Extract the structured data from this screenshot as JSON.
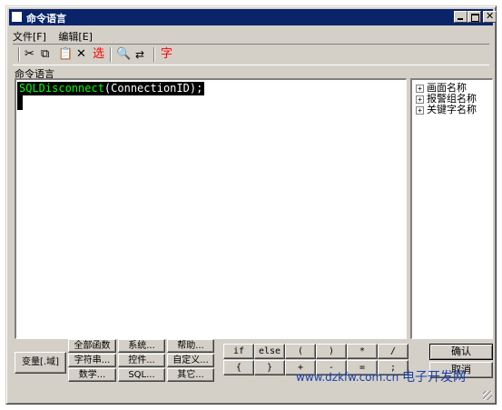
{
  "window": {
    "title": "命令语言"
  },
  "menu": [
    "文件[F]",
    "编辑[E]"
  ],
  "toolbar": {
    "icons": [
      "cut-icon",
      "copy-icon",
      "paste-icon",
      "delete-icon",
      "select-icon",
      "find-icon",
      "replace-icon",
      "font-icon"
    ],
    "select_label": "选",
    "font_label": "字"
  },
  "editor": {
    "section_label": "命令语言",
    "code_keyword": "SQLDisconnect",
    "code_rest": "(ConnectionID);"
  },
  "tree": {
    "items": [
      "画面名称",
      "报警组名称",
      "关键字名称"
    ]
  },
  "buttons": {
    "variable": "变量[.域]",
    "functions": [
      "全部函数",
      "系统...",
      "帮助...",
      "字符串...",
      "控件...",
      "自定义...",
      "数学...",
      "SQL...",
      "其它..."
    ],
    "symbols": [
      "if",
      "else",
      "(",
      ")",
      "*",
      "/",
      "{",
      "}",
      "+",
      "-",
      "=",
      ";"
    ],
    "ok": "确认",
    "cancel": "取消"
  },
  "watermark": {
    "url": "www.dzkfw.com.cn",
    "text": "电子开发网"
  },
  "colors": {
    "titlebar": "#0a246a",
    "face": "#d4d0c8",
    "keyword": "#00ff00",
    "accent_red": "#ff0000"
  }
}
